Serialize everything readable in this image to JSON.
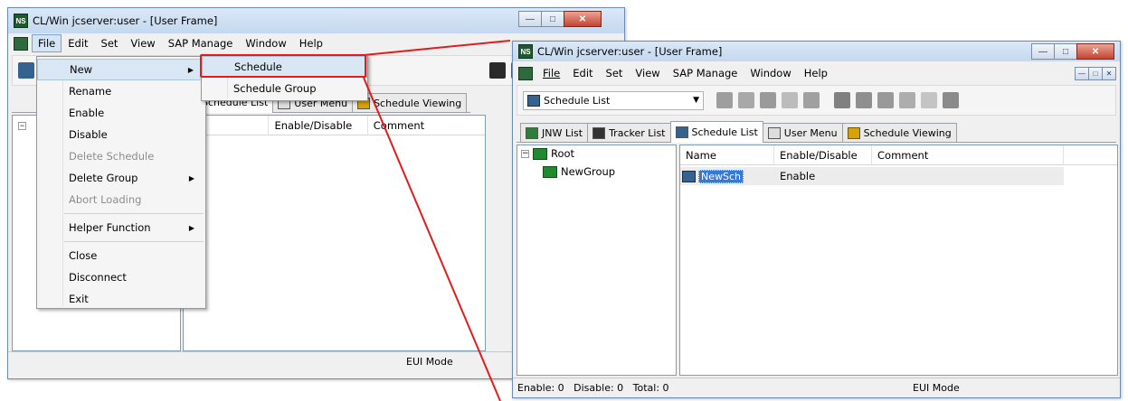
{
  "left_window": {
    "title": "CL/Win jcserver:user - [User Frame]",
    "app_icon": "NS",
    "menu": [
      "File",
      "Edit",
      "Set",
      "View",
      "SAP Manage",
      "Window",
      "Help"
    ],
    "file_menu": [
      {
        "label": "New",
        "has_submenu": true,
        "highlighted": true
      },
      {
        "label": "Rename"
      },
      {
        "label": "Enable"
      },
      {
        "label": "Disable"
      },
      {
        "label": "Delete Schedule",
        "disabled": true
      },
      {
        "label": "Delete Group",
        "has_submenu": true
      },
      {
        "label": "Abort Loading",
        "disabled": true
      },
      {
        "label": "Helper Function",
        "has_submenu": true
      },
      {
        "label": "Close"
      },
      {
        "label": "Disconnect"
      },
      {
        "label": "Exit"
      }
    ],
    "new_submenu": [
      "Schedule",
      "Schedule Group"
    ],
    "tabs_partial": [
      "Schedule List",
      "User Menu",
      "Schedule Viewing"
    ],
    "columns_partial": [
      "me",
      "Enable/Disable",
      "Comment"
    ],
    "status": "EUI Mode"
  },
  "right_window": {
    "title": "CL/Win jcserver:user - [User Frame]",
    "app_icon": "NS",
    "menu": [
      "File",
      "Edit",
      "Set",
      "View",
      "SAP Manage",
      "Window",
      "Help"
    ],
    "combo_value": "Schedule List",
    "tabs": [
      "JNW List",
      "Tracker List",
      "Schedule List",
      "User Menu",
      "Schedule Viewing"
    ],
    "selected_tab": "Schedule List",
    "tree": {
      "root": "Root",
      "child": "NewGroup"
    },
    "columns": [
      "Name",
      "Enable/Disable",
      "Comment"
    ],
    "rows": [
      {
        "name": "NewSch",
        "state": "Enable"
      }
    ],
    "status_left": "Enable: 0   Disable: 0   Total: 0",
    "status_right": "EUI Mode"
  },
  "colors": {
    "callout": "#e31b1b",
    "menu_highlight": "#d9e6f4",
    "title_gradient": "#c5d8ef"
  },
  "close_glyph": "✕",
  "minimize_glyph": "—",
  "maximize_glyph": "□"
}
